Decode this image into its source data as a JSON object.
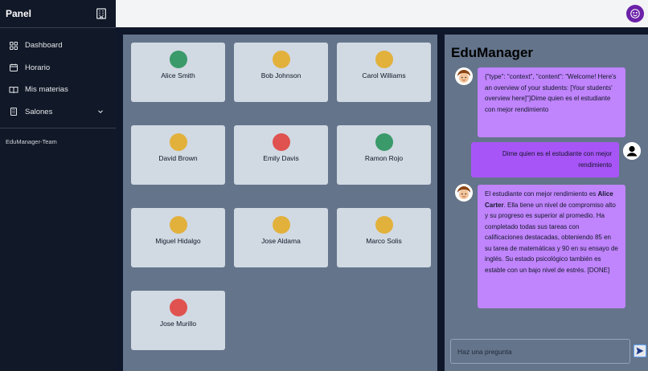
{
  "sidebar": {
    "title": "Panel",
    "items": [
      {
        "label": "Dashboard",
        "icon": "grid-icon"
      },
      {
        "label": "Horario",
        "icon": "calendar-icon"
      },
      {
        "label": "Mis materias",
        "icon": "book-icon"
      },
      {
        "label": "Salones",
        "icon": "building-icon"
      }
    ],
    "team": "EduManager-Team"
  },
  "students": [
    {
      "name": "Alice Smith",
      "status_color": "#3a9a6a"
    },
    {
      "name": "Bob Johnson",
      "status_color": "#e2b13c"
    },
    {
      "name": "Carol Williams",
      "status_color": "#e2b13c"
    },
    {
      "name": "David Brown",
      "status_color": "#e2b13c"
    },
    {
      "name": "Emily Davis",
      "status_color": "#e0524f"
    },
    {
      "name": "Ramon Rojo",
      "status_color": "#3a9a6a"
    },
    {
      "name": "Miguel Hidalgo",
      "status_color": "#e2b13c"
    },
    {
      "name": "Jose Aldama",
      "status_color": "#e2b13c"
    },
    {
      "name": "Marco Solis",
      "status_color": "#e2b13c"
    },
    {
      "name": "Jose Murillo",
      "status_color": "#e0524f"
    }
  ],
  "chat": {
    "title": "EduManager",
    "messages": {
      "m1": "{\"type\": \"context\", \"content\": \"Welcome! Here's an overview of your students: [Your students' overview here]\"}Dime quien es el estudiante con mejor rendimiento",
      "m2": "Dime quien es el estudiante con mejor rendimiento",
      "m3_pre": "El estudiante con mejor rendimiento es ",
      "m3_bold": "Alice Carter",
      "m3_post": ". Ella tiene un nivel de compromiso alto y su progreso es superior al promedio. Ha completado todas sus tareas con calificaciones destacadas, obteniendo 85 en su tarea de matemáticas y 90 en su ensayo de inglés. Su estado psicológico también es estable con un bajo nivel de estrés. [DONE]"
    },
    "input_placeholder": "Haz una pregunta"
  }
}
